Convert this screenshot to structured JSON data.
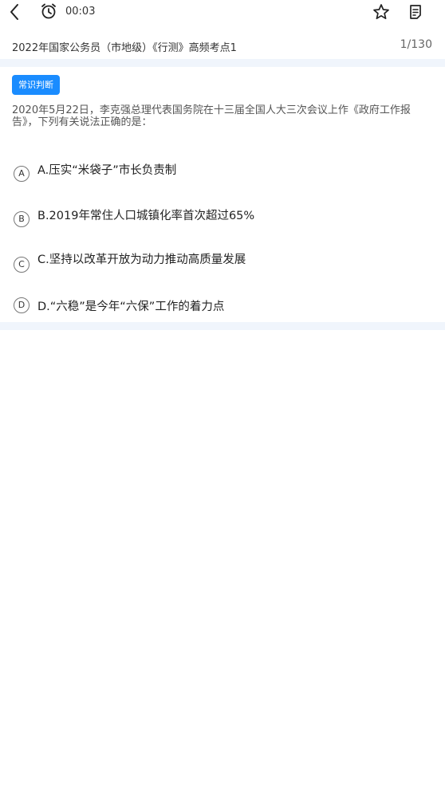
{
  "topbar": {
    "timer": "00:03",
    "icons": {
      "back": "chevron-left-icon",
      "timer": "alarm-clock-icon",
      "favorite": "star-icon",
      "answer_sheet": "answer-sheet-icon"
    }
  },
  "paper": {
    "title": "2022年国家公务员（市地级）《行测》高频考点1",
    "progress": "1/130"
  },
  "question": {
    "type_badge": "常识判断",
    "stem": "2020年5月22日，李克强总理代表国务院在十三届全国人大三次会议上作《政府工作报告》，下列有关说法正确的是：",
    "options": [
      {
        "letter": "A",
        "text": "A.压实“米袋子”市长负责制"
      },
      {
        "letter": "B",
        "text": "B.2019年常住人口城镇化率首次超过65%"
      },
      {
        "letter": "C",
        "text": "C.坚持以改革开放为动力推动高质量发展"
      },
      {
        "letter": "D",
        "text": "D.“六稳”是今年“六保”工作的着力点"
      }
    ]
  },
  "colors": {
    "accent": "#1a8cff",
    "band": "#f0f5fc"
  }
}
